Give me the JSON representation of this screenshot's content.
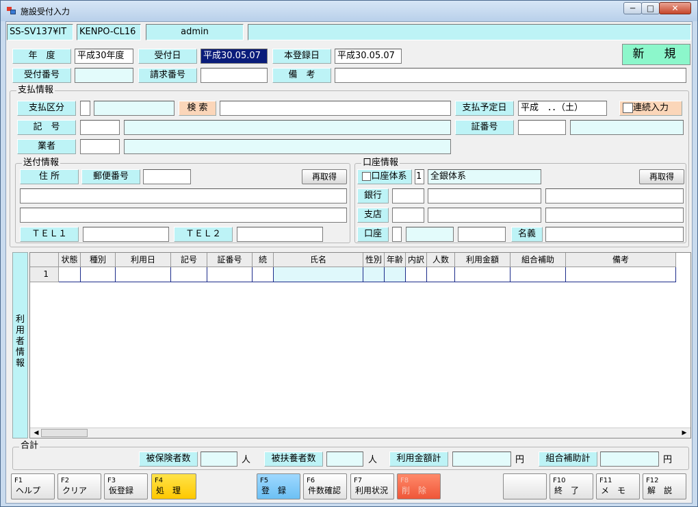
{
  "window": {
    "title": "施設受付入力",
    "min_glyph": "─",
    "max_glyph": "□",
    "close_glyph": "✕"
  },
  "status_bar": {
    "server": "SS-SV137¥IT",
    "client": "KENPO-CL16",
    "user": "admin",
    "message": ""
  },
  "header": {
    "year_label": "年　度",
    "year_value": "平成30年度",
    "receipt_date_label": "受付日",
    "receipt_date_value": "平成30.05.07",
    "registration_date_label": "本登録日",
    "registration_date_value": "平成30.05.07",
    "new_label": "新　規",
    "receipt_no_label": "受付番号",
    "receipt_no_value": "",
    "invoice_no_label": "請求番号",
    "invoice_no_value": "",
    "remarks_label": "備　考",
    "remarks_value": ""
  },
  "payment": {
    "group_title": "支払情報",
    "type_label": "支払区分",
    "type_code": "",
    "type_name": "",
    "search_label": "検 索",
    "search_value": "",
    "scheduled_label": "支払予定日",
    "scheduled_value": "平成　．．（土）",
    "continuous_label": "連続入力",
    "symbol_label": "記　号",
    "symbol_code": "",
    "symbol_name": "",
    "cert_label": "証番号",
    "cert_value": "",
    "cert_value2": "",
    "vendor_label": "業者",
    "vendor_code": "",
    "vendor_name": ""
  },
  "shipping": {
    "group_title": "送付情報",
    "address_label": "住 所",
    "zip_label": "郵便番号",
    "zip_value": "",
    "refetch_label": "再取得",
    "address1": "",
    "address2": "",
    "tel1_label": "ＴＥＬ１",
    "tel1_value": "",
    "tel2_label": "ＴＥＬ２",
    "tel2_value": ""
  },
  "account": {
    "group_title": "口座情報",
    "system_label": "口座体系",
    "system_code": "1",
    "system_name": "全銀体系",
    "refetch_label": "再取得",
    "bank_label": "銀行",
    "bank_code": "",
    "bank_name": "",
    "bank_extra": "",
    "branch_label": "支店",
    "branch_code": "",
    "branch_name": "",
    "branch_extra": "",
    "account_label": "口座",
    "account_type": "",
    "account_no": "",
    "account_extra": "",
    "holder_label": "名義",
    "holder_value": ""
  },
  "users": {
    "side_label": [
      "利",
      "用",
      "者",
      "情",
      "報"
    ],
    "columns": [
      "状態",
      "種別",
      "利用日",
      "記号",
      "証番号",
      "続",
      "氏名",
      "性別",
      "年齢",
      "内訳",
      "人数",
      "利用金額",
      "組合補助",
      "備考"
    ],
    "rows": [
      {
        "no": "1"
      }
    ]
  },
  "scroll": {
    "left": "◀",
    "right": "▶"
  },
  "totals": {
    "group_title": "合計",
    "insured_label": "被保険者数",
    "insured_value": "",
    "insured_unit": "人",
    "dependent_label": "被扶養者数",
    "dependent_value": "",
    "dependent_unit": "人",
    "amount_label": "利用金額計",
    "amount_value": "",
    "amount_unit": "円",
    "subsidy_label": "組合補助計",
    "subsidy_value": "",
    "subsidy_unit": "円"
  },
  "fkeys": [
    {
      "key": "F1",
      "label": "ヘルプ"
    },
    {
      "key": "F2",
      "label": "クリア"
    },
    {
      "key": "F3",
      "label": "仮登録"
    },
    {
      "key": "F4",
      "label": "処　理"
    },
    {
      "key": "F5",
      "label": "登　録"
    },
    {
      "key": "F6",
      "label": "件数確認"
    },
    {
      "key": "F7",
      "label": "利用状況"
    },
    {
      "key": "F8",
      "label": "削　除"
    },
    {
      "key": "",
      "label": ""
    },
    {
      "key": "F10",
      "label": "終　了"
    },
    {
      "key": "F11",
      "label": "メ　モ"
    },
    {
      "key": "F12",
      "label": "解　説"
    }
  ],
  "colors": {
    "label_bg": "#bdf3f6",
    "new_bg": "#8cf7cb",
    "f4": "#ffd21f",
    "f5": "#7fcaf7",
    "f8": "#f2663f"
  }
}
